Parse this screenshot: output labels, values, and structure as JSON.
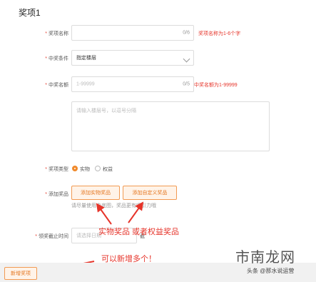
{
  "section": {
    "title": "奖项1"
  },
  "fields": {
    "prize_name": {
      "label": "奖项名称",
      "counter": "0/6",
      "hint": "奖项名称为1-6个字"
    },
    "condition": {
      "label": "中奖条件",
      "value": "指定楼层"
    },
    "quota": {
      "label": "中奖名额",
      "placeholder": "1-99999",
      "counter": "0/5",
      "hint": "中奖名额为1-99999"
    },
    "floors": {
      "placeholder": "请输入楼层号，以逗号分隔"
    },
    "prize_type": {
      "label": "奖项类型",
      "options": [
        "实物",
        "权益"
      ],
      "selected": "实物"
    },
    "add_prize": {
      "label": "添加奖品",
      "btn_physical": "添加实物奖品",
      "btn_custom": "添加自定义奖品",
      "hint": "请尽量使用白底图，奖品更有吸引力哦"
    },
    "deadline": {
      "label": "领奖截止时间",
      "placeholder": "请选择日期",
      "suffix": "截"
    }
  },
  "annotations": {
    "prize_types": "实物奖品 或者权益奖品",
    "add_more": "可以新增多个！"
  },
  "footer": {
    "add_button": "新增奖项"
  },
  "watermark": {
    "main": "市南龙网",
    "sub": "头条 @那水说运营"
  },
  "colors": {
    "accent": "#f08a2c",
    "error": "#e6342a"
  }
}
